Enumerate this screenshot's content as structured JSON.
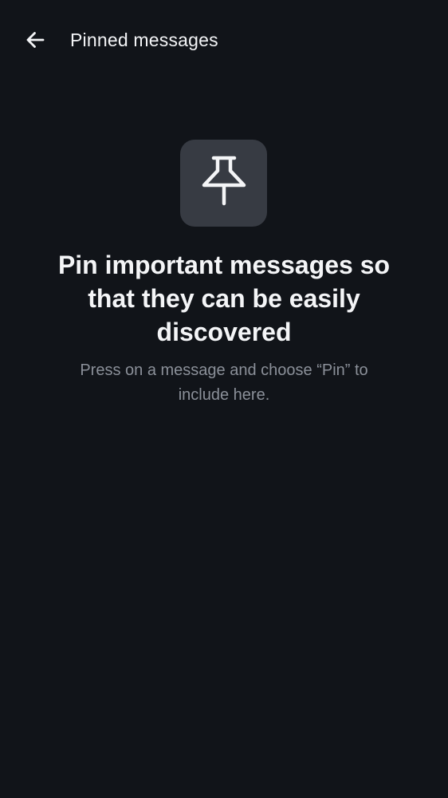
{
  "header": {
    "back_icon": "arrow-left-icon",
    "title": "Pinned messages"
  },
  "empty_state": {
    "icon": "pushpin-icon",
    "heading": "Pin important messages so that they can be easily discovered",
    "description": "Press on a message and choose “Pin” to include here."
  },
  "colors": {
    "background": "#111419",
    "icon_tile": "#373b43",
    "primary_text": "#f4f5f7",
    "secondary_text": "#8b9099"
  }
}
